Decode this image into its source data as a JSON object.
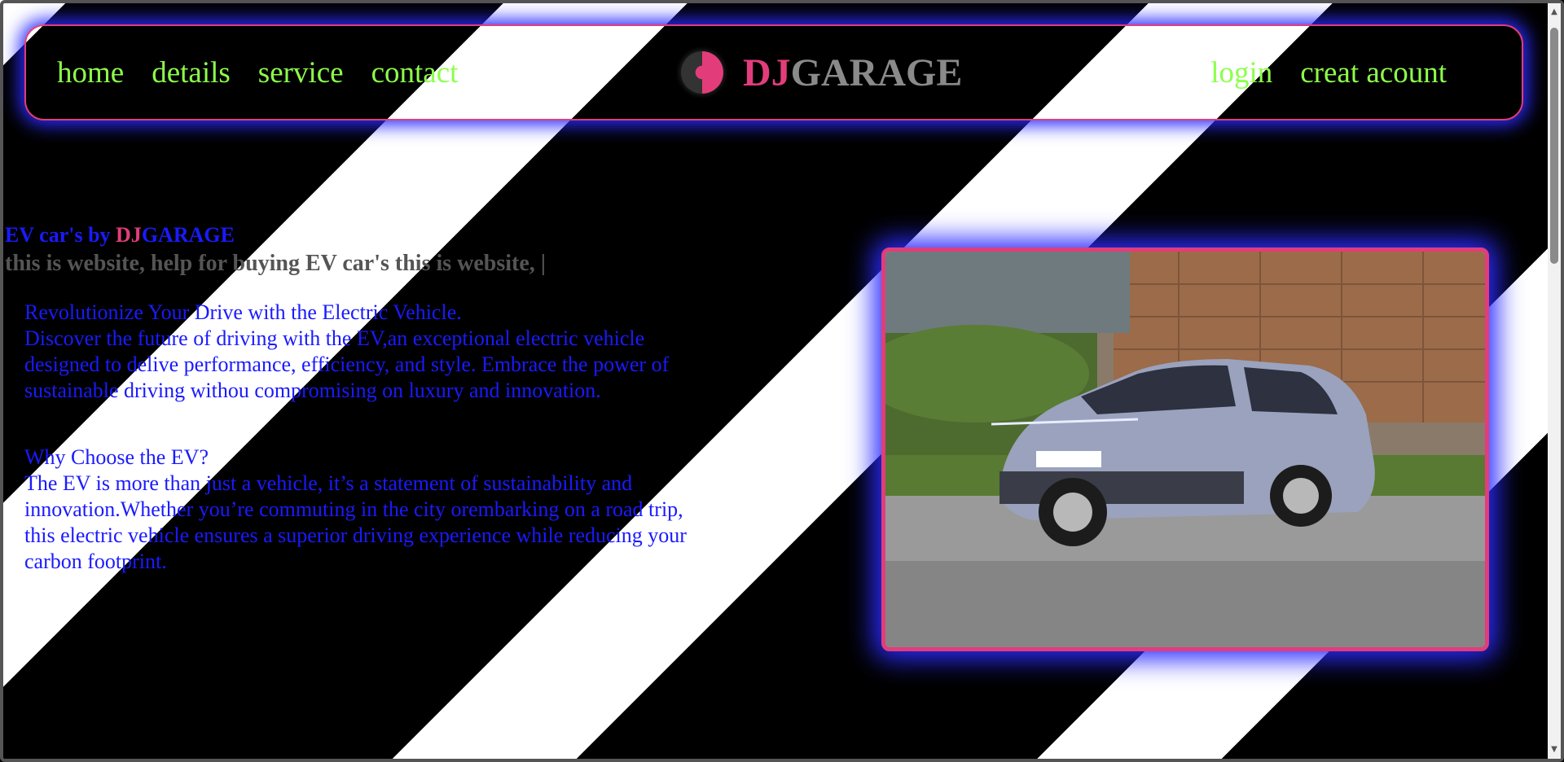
{
  "nav": {
    "left_links": [
      "home",
      "details",
      "service",
      "contact"
    ],
    "right_links": [
      "login",
      "creat acount"
    ],
    "brand": {
      "part1": "DJ",
      "part2": "GARAGE",
      "logo_icon": "garage-logo-icon"
    }
  },
  "hero": {
    "title_prefix": "EV car's by ",
    "title_dj": "DJ",
    "title_garage": "GARAGE",
    "typing_text": "this is website, help for buying EV car's this is website, |"
  },
  "content": {
    "heading1": "Revolutionize Your Drive with the Electric Vehicle.",
    "para1": "Discover the future of driving with the EV,an exceptional electric vehicle designed to delive performance, efficiency, and style. Embrace the power of sustainable driving withou compromising on luxury and innovation.",
    "heading2": "Why Choose the EV?",
    "para2": "The EV is more than just a vehicle, it’s a statement of sustainability and innovation.Whether you’re commuting in the city orembarking on a road trip, this electric vehicle ensures a superior driving experience while reducing your carbon footprint."
  },
  "image": {
    "semantic": "electric-suv-photo"
  },
  "colors": {
    "accent_pink": "#e23d7a",
    "nav_green": "#8cff4a",
    "text_blue": "#1a1aff",
    "glow_blue": "#2b2bff"
  }
}
